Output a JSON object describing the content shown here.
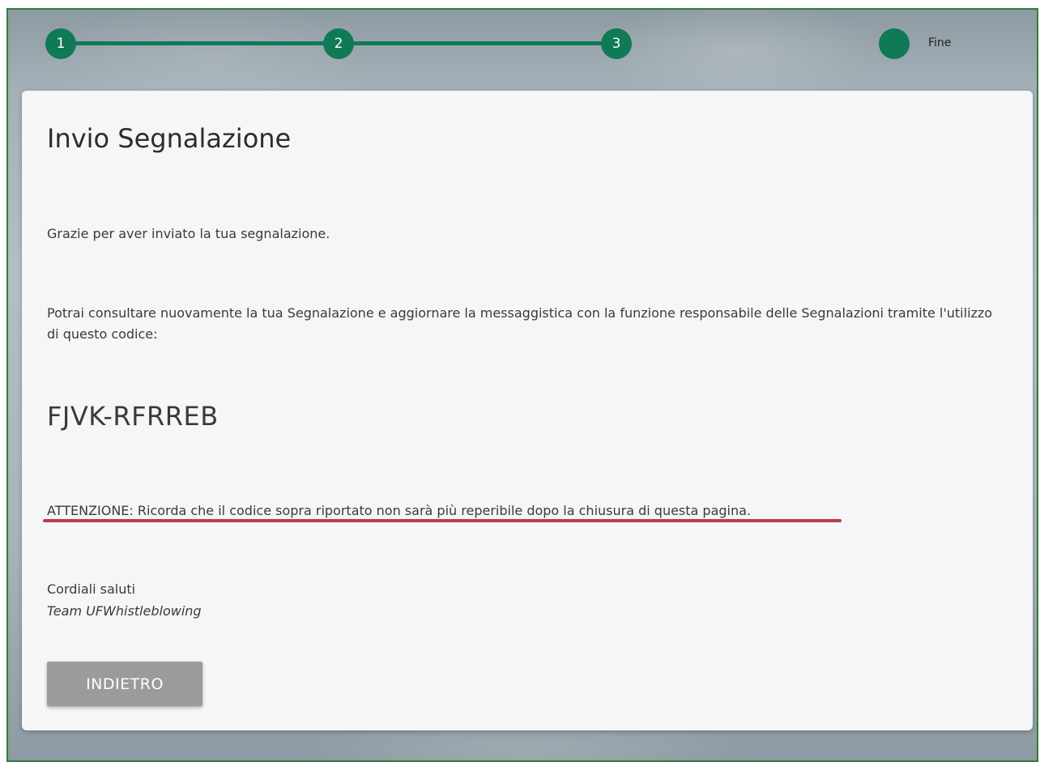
{
  "stepper": {
    "steps": [
      {
        "label": "1"
      },
      {
        "label": "2"
      },
      {
        "label": "3"
      },
      {
        "label": ""
      }
    ],
    "final_label": "Fine",
    "accent_color": "#0f7a55"
  },
  "card": {
    "title": "Invio Segnalazione",
    "thanks_text": "Grazie per aver inviato la tua segnalazione.",
    "info_text": "Potrai consultare nuovamente la tua Segnalazione e aggiornare la messaggistica con la funzione responsabile delle Segnalazioni tramite l'utilizzo di questo codice:",
    "code": "FJVK-RFRREB",
    "warning_text": "ATTENZIONE: Ricorda che il codice sopra riportato non sarà più reperibile dopo la chiusura di questa pagina.",
    "regards_text": "Cordiali saluti",
    "team_text": "Team UFWhistleblowing",
    "back_button_label": "INDIETRO"
  }
}
